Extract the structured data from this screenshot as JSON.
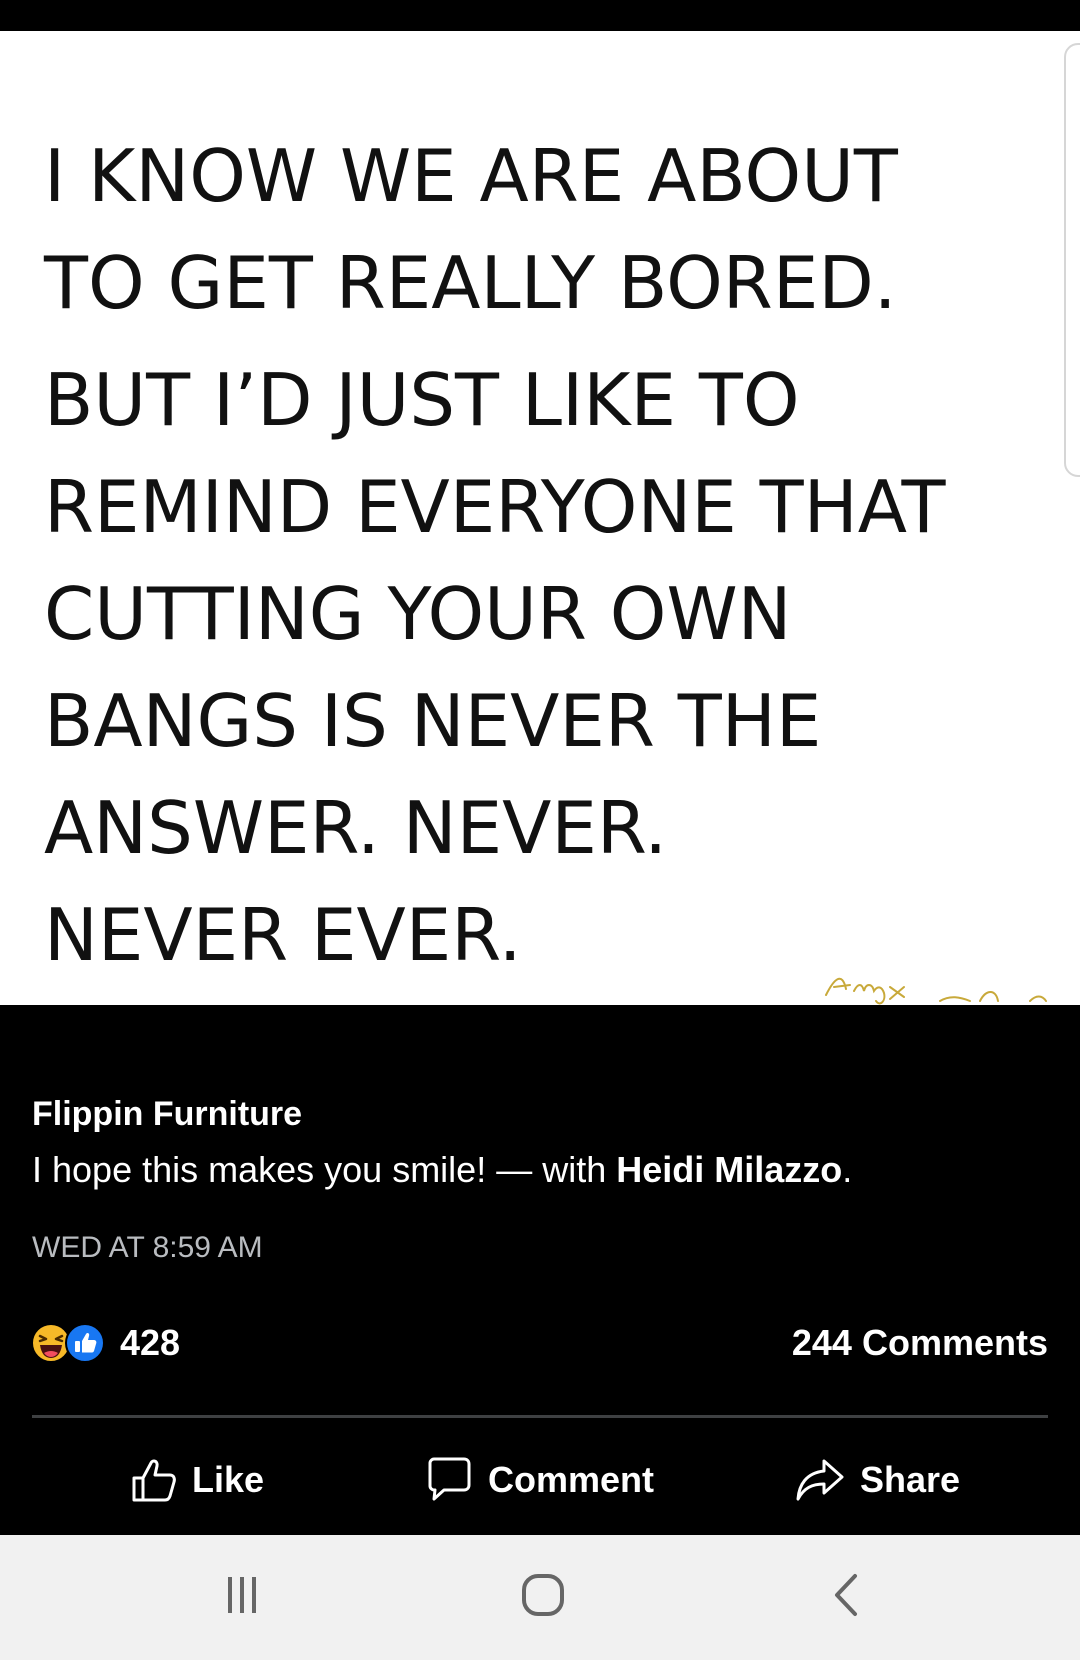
{
  "post_image": {
    "quote_lines": [
      "I KNOW WE ARE ABOUT",
      "TO GET REALLY BORED.",
      "BUT I’D JUST LIKE TO",
      "REMIND EVERYONE THAT",
      "CUTTING YOUR OWN",
      "BANGS IS NEVER THE",
      "ANSWER. NEVER.",
      "NEVER EVER."
    ],
    "signature_text": "Amy",
    "signature_color": "#c8a93a"
  },
  "post": {
    "page_name": "Flippin Furniture",
    "caption_text": "I hope this makes you smile! — with ",
    "tagged_name": "Heidi Milazzo",
    "caption_end": ".",
    "timestamp": "WED AT 8:59 AM"
  },
  "reactions": {
    "icons": [
      "laughing-emoji-icon",
      "like-thumb-icon"
    ],
    "count": "428",
    "comments": "244 Comments"
  },
  "actions": {
    "like_label": "Like",
    "comment_label": "Comment",
    "share_label": "Share"
  },
  "nav_bar": {
    "icons": [
      "recents-icon",
      "home-icon",
      "back-icon"
    ]
  },
  "colors": {
    "background": "#000000",
    "image_background": "#ffffff",
    "text": "#ffffff",
    "muted_text": "#b9bcc0",
    "like_blue": "#1877f2",
    "emoji_yellow": "#f7b928",
    "nav_bar": "#f1f1f1"
  }
}
